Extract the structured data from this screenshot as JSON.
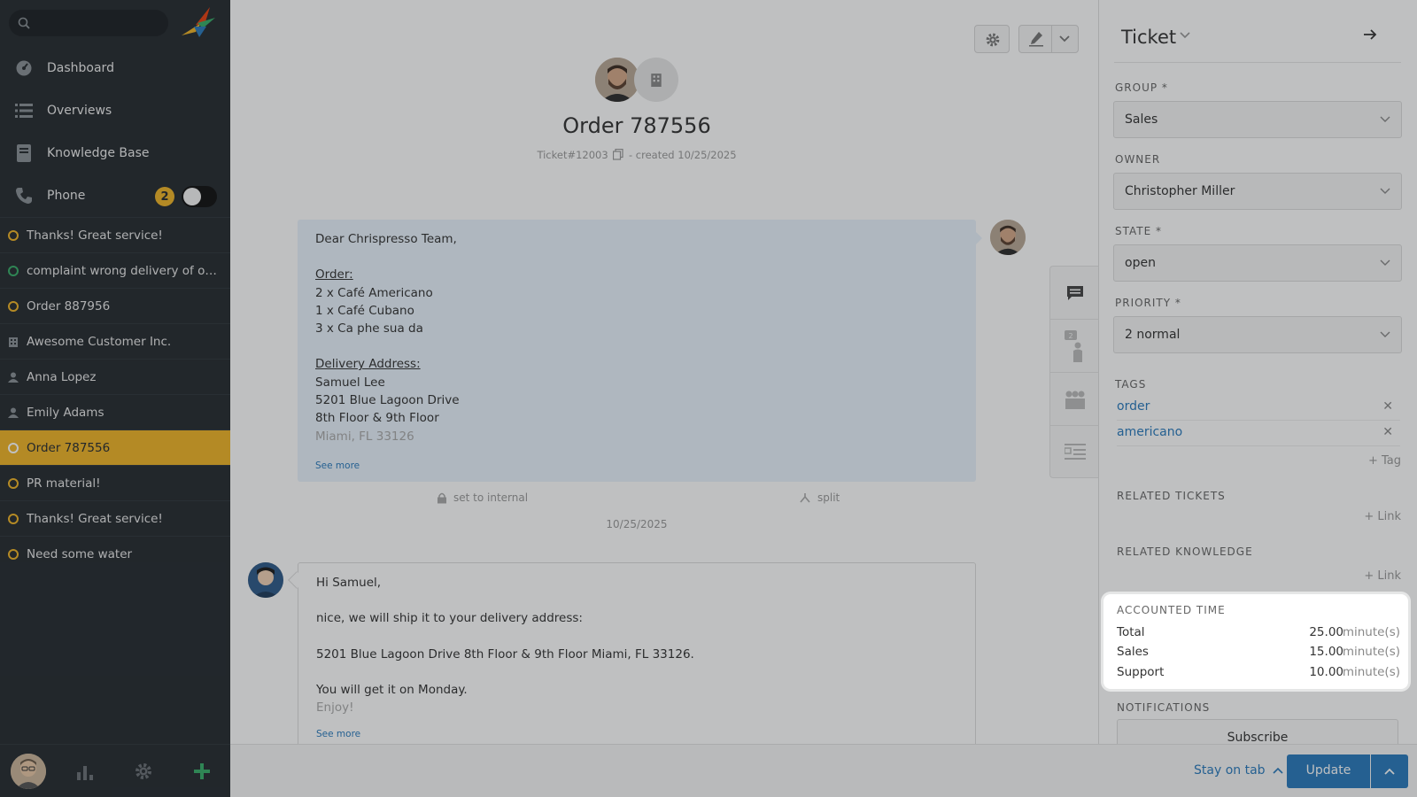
{
  "sidebar": {
    "nav": [
      {
        "label": "Dashboard",
        "icon": "dashboard-icon"
      },
      {
        "label": "Overviews",
        "icon": "list-icon"
      },
      {
        "label": "Knowledge Base",
        "icon": "book-icon"
      },
      {
        "label": "Phone",
        "icon": "phone-icon",
        "badge": "2"
      }
    ],
    "tasks": [
      {
        "label": "Thanks! Great service!",
        "kind": "ticket-open"
      },
      {
        "label": "complaint wrong delivery of ord...",
        "kind": "ticket-new"
      },
      {
        "label": "Order 887956",
        "kind": "ticket-open"
      },
      {
        "label": "Awesome Customer Inc.",
        "kind": "organization"
      },
      {
        "label": "Anna Lopez",
        "kind": "user"
      },
      {
        "label": "Emily Adams",
        "kind": "user"
      },
      {
        "label": "Order 787556",
        "kind": "ticket-open",
        "active": true
      },
      {
        "label": "PR material!",
        "kind": "ticket-open"
      },
      {
        "label": "Thanks! Great service!",
        "kind": "ticket-open"
      },
      {
        "label": "Need some water",
        "kind": "ticket-open"
      }
    ]
  },
  "ticket": {
    "title": "Order 787556",
    "number": "Ticket#12003",
    "created": "- created 10/25/2025",
    "article1": {
      "greeting": "Dear Chrispresso Team,",
      "order_heading": "Order:",
      "order_lines": [
        "2 x Café Americano",
        "1 x Café Cubano",
        "3 x Ca phe sua da"
      ],
      "address_heading": "Delivery Address:",
      "address_lines": [
        "Samuel Lee",
        "5201 Blue Lagoon Drive",
        "8th Floor & 9th Floor"
      ],
      "address_faded": "Miami, FL 33126",
      "see_more": "See more"
    },
    "actions": {
      "internal": "set to internal",
      "split": "split"
    },
    "date_separator": "10/25/2025",
    "article2": {
      "greeting": "Hi Samuel,",
      "line1": "nice, we will ship it to your delivery address:",
      "line2": "5201 Blue Lagoon Drive 8th Floor & 9th Floor Miami, FL 33126.",
      "line3": "You will get it on Monday.",
      "line4": "Enjoy!",
      "see_more": "See more"
    }
  },
  "panel": {
    "title": "Ticket",
    "group": {
      "label": "Group *",
      "value": "Sales"
    },
    "owner": {
      "label": "Owner",
      "value": "Christopher Miller"
    },
    "state": {
      "label": "State *",
      "value": "open"
    },
    "priority": {
      "label": "Priority *",
      "value": "2 normal"
    },
    "tags_label": "Tags",
    "tags": [
      "order",
      "americano"
    ],
    "add_tag": "+ Tag",
    "related_tickets": "Related Tickets",
    "related_knowledge": "Related Knowledge",
    "add_link": "+ Link",
    "accounted_time": {
      "heading": "Accounted Time",
      "unit": "minute(s)",
      "rows": [
        {
          "label": "Total",
          "value": "25.00"
        },
        {
          "label": "Sales",
          "value": "15.00"
        },
        {
          "label": "Support",
          "value": "10.00"
        }
      ]
    },
    "notifications": "Notifications",
    "subscribe": "Subscribe"
  },
  "bottombar": {
    "stay_on_tab": "Stay on tab",
    "update": "Update"
  },
  "colors": {
    "sidebar_bg": "#262b30",
    "accent": "#f0b428",
    "link": "#2a7bbd",
    "article_customer_bg": "#e9f3fc"
  }
}
